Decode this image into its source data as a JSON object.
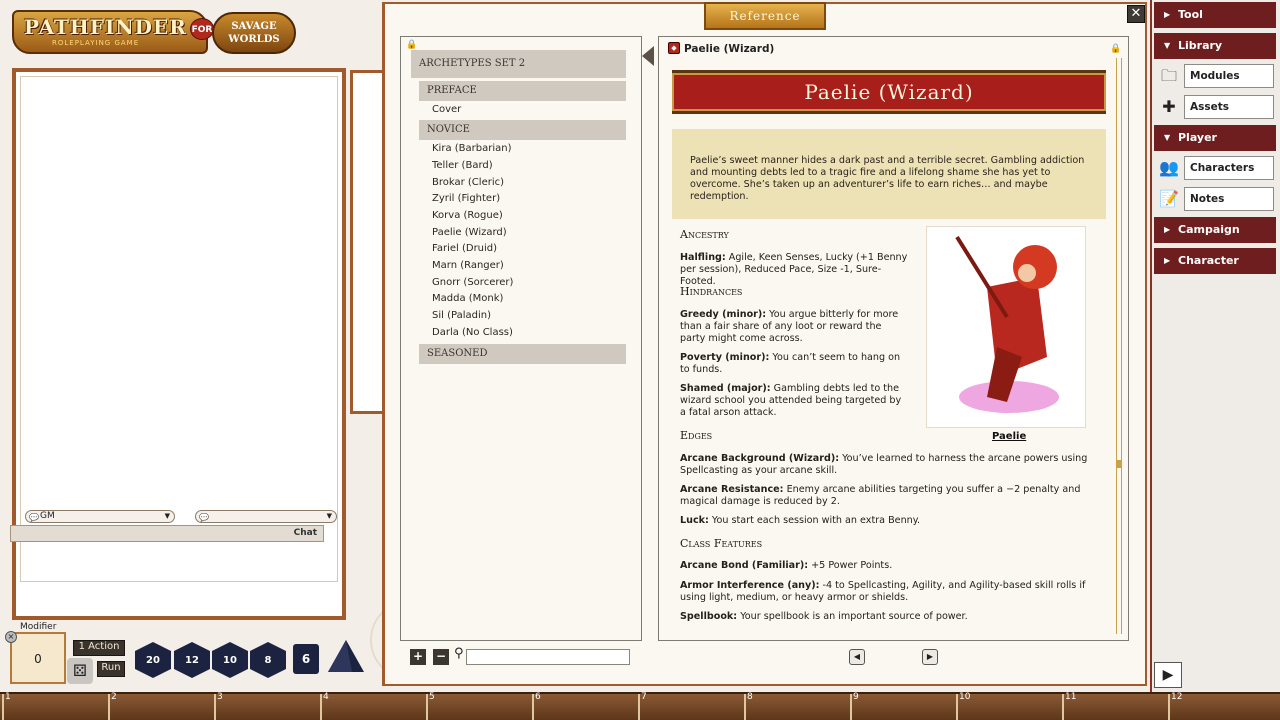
{
  "logo": {
    "main": "PATHFINDER",
    "sub": "ROLEPLAYING GAME",
    "for": "FOR",
    "sw": "SAVAGE WORLDS"
  },
  "chat": {
    "identity": "GM",
    "language": "",
    "chat_label": "Chat"
  },
  "modifier": {
    "label": "Modifier",
    "value": "0",
    "action_label": "1 Action",
    "run_label": "Run"
  },
  "dice": [
    "20",
    "12",
    "10",
    "8",
    "6"
  ],
  "reference": {
    "window_title": "Reference",
    "close_glyph": "✕",
    "groups": [
      {
        "label": "Archetypes Set 2"
      },
      {
        "label": "Preface",
        "items": [
          "Cover"
        ]
      },
      {
        "label": "Novice",
        "items": [
          "Kira (Barbarian)",
          "Teller (Bard)",
          "Brokar (Cleric)",
          "Zyril (Fighter)",
          "Korva (Rogue)",
          "Paelie (Wizard)",
          "Fariel (Druid)",
          "Marn (Ranger)",
          "Gnorr (Sorcerer)",
          "Madda (Monk)",
          "Sil (Paladin)",
          "Darla (No Class)"
        ]
      },
      {
        "label": "Seasoned"
      }
    ],
    "doc": {
      "title": "Paelie (Wizard)",
      "banner": "Paelie (Wizard)",
      "intro": "Paelie’s sweet manner hides a dark past and a terrible secret. Gambling addiction and mounting debts led to a tragic fire and a lifelong shame she has yet to overcome. She’s taken up an adventurer’s life to earn riches… and maybe redemption.",
      "ancestry_h": "Ancestry",
      "ancestry_b": "Halfling:",
      "ancestry_t": " Agile, Keen Senses, Lucky (+1 Benny per session), Reduced Pace, Size -1, Sure-Footed.",
      "hindrances_h": "Hindrances",
      "h1_b": "Greedy (minor):",
      "h1_t": " You argue bitterly for more than a fair share of any loot or reward the party might come across.",
      "h2_b": "Poverty (minor):",
      "h2_t": " You can’t seem to hang on to funds.",
      "h3_b": "Shamed (major):",
      "h3_t": " Gambling debts led to the wizard school you attended being targeted by a fatal arson attack.",
      "edges_h": "Edges",
      "e1_b": "Arcane Background (Wizard):",
      "e1_t": " You’ve learned to harness the arcane powers using Spellcasting as your arcane skill.",
      "e2_b": "Arcane Resistance:",
      "e2_t": " Enemy arcane abilities targeting you suffer a −2 penalty and magical damage is reduced by 2.",
      "e3_b": "Luck:",
      "e3_t": " You start each session with an extra Benny.",
      "class_h": "Class Features",
      "c1_b": "Arcane Bond (Familiar):",
      "c1_t": " +5 Power Points.",
      "c2_b": "Armor Interference (any):",
      "c2_t": " -4 to Spellcasting, Agility, and Agility-based skill rolls if using light, medium, or heavy armor or shields.",
      "c3_b": "Spellbook:",
      "c3_t": " Your spellbook is an important source of power.",
      "caption": "Paelie"
    }
  },
  "sidebar": {
    "tool": "Tool",
    "library": "Library",
    "modules": "Modules",
    "assets": "Assets",
    "player": "Player",
    "characters": "Characters",
    "notes": "Notes",
    "campaign": "Campaign",
    "character": "Character"
  },
  "hotbar": [
    "1",
    "2",
    "3",
    "4",
    "5",
    "6",
    "7",
    "8",
    "9",
    "10",
    "11",
    "12"
  ],
  "colors": {
    "accent": "#a81e1a",
    "frame": "#a05a2c",
    "sidebar_header": "#6e1e1e"
  }
}
